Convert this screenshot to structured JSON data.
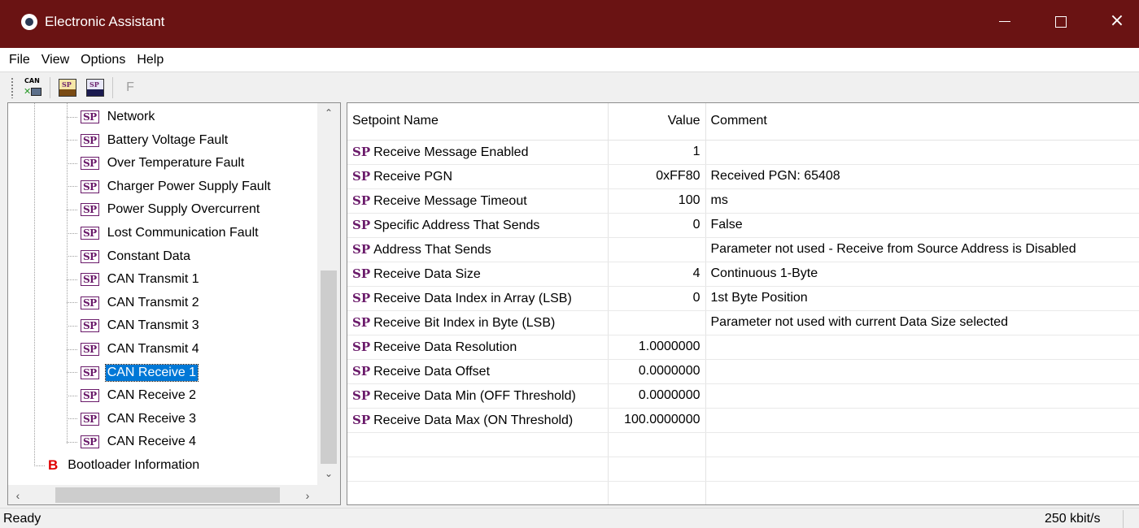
{
  "window": {
    "title": "Electronic Assistant",
    "minimize": "minimize",
    "maximize": "maximize",
    "close": "×"
  },
  "menu": [
    "File",
    "View",
    "Options",
    "Help"
  ],
  "toolbar": {
    "can_label": "CAN",
    "sp_label": "SP",
    "f_label": "F"
  },
  "tree": {
    "items": [
      "Network",
      "Battery Voltage Fault",
      "Over Temperature Fault",
      "Charger Power Supply Fault",
      "Power Supply Overcurrent",
      "Lost Communication Fault",
      "Constant Data",
      "CAN Transmit 1",
      "CAN Transmit 2",
      "CAN Transmit 3",
      "CAN Transmit 4",
      "CAN Receive 1",
      "CAN Receive 2",
      "CAN Receive 3",
      "CAN Receive 4"
    ],
    "selected": "CAN Receive 1",
    "sp_badge": "SP",
    "bootloader": {
      "badge": "B",
      "label": "Bootloader Information"
    }
  },
  "grid": {
    "headers": {
      "name": "Setpoint Name",
      "value": "Value",
      "comment": "Comment"
    },
    "sp_tag": "SP",
    "rows": [
      {
        "name": "Receive Message Enabled",
        "value": "1",
        "comment": ""
      },
      {
        "name": "Receive PGN",
        "value": "0xFF80",
        "comment": "Received PGN: 65408"
      },
      {
        "name": "Receive Message Timeout",
        "value": "100",
        "comment": "ms"
      },
      {
        "name": "Specific Address That Sends",
        "value": "0",
        "comment": "False"
      },
      {
        "name": "Address That Sends",
        "value": "",
        "comment": "Parameter not used - Receive from Source Address is Disabled"
      },
      {
        "name": "Receive Data Size",
        "value": "4",
        "comment": "Continuous 1-Byte"
      },
      {
        "name": "Receive Data Index in Array (LSB)",
        "value": "0",
        "comment": "1st Byte Position"
      },
      {
        "name": "Receive Bit Index in Byte (LSB)",
        "value": "",
        "comment": "Parameter not used with current Data Size selected"
      },
      {
        "name": "Receive Data Resolution",
        "value": "1.0000000",
        "comment": ""
      },
      {
        "name": "Receive Data Offset",
        "value": "0.0000000",
        "comment": ""
      },
      {
        "name": "Receive Data Min (OFF Threshold)",
        "value": "0.0000000",
        "comment": ""
      },
      {
        "name": "Receive Data Max (ON Threshold)",
        "value": "100.0000000",
        "comment": ""
      }
    ],
    "empty_rows": 3
  },
  "status": {
    "left": "Ready",
    "right": "250 kbit/s"
  },
  "colors": {
    "titlebar": "#6a1313",
    "selection": "#0078d7",
    "sp_purple": "#6a1a6a",
    "bootloader_red": "#e00000"
  }
}
